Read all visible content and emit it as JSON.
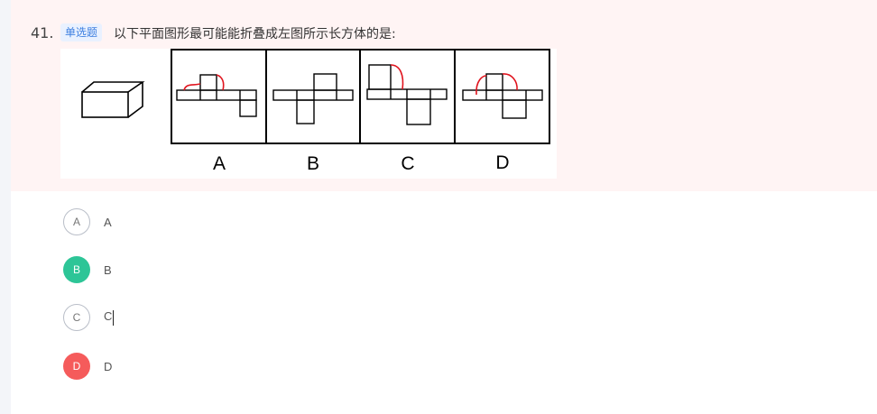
{
  "question": {
    "number": "41.",
    "type_badge": "单选题",
    "text": "以下平面图形最可能能折叠成左图所示长方体的是:"
  },
  "figure": {
    "labels": [
      "A",
      "B",
      "C",
      "D"
    ],
    "highlight_color": "#e0141e"
  },
  "options": [
    {
      "letter": "A",
      "text": "A",
      "state": "default"
    },
    {
      "letter": "B",
      "text": "B",
      "state": "correct"
    },
    {
      "letter": "C",
      "text": "C",
      "state": "default"
    },
    {
      "letter": "D",
      "text": "D",
      "state": "wrong"
    }
  ],
  "colors": {
    "correct": "#2dc597",
    "wrong": "#f55b5b",
    "badge_bg": "#e9f1ff",
    "badge_text": "#3d7fe0",
    "question_bg": "#fff4f4"
  }
}
